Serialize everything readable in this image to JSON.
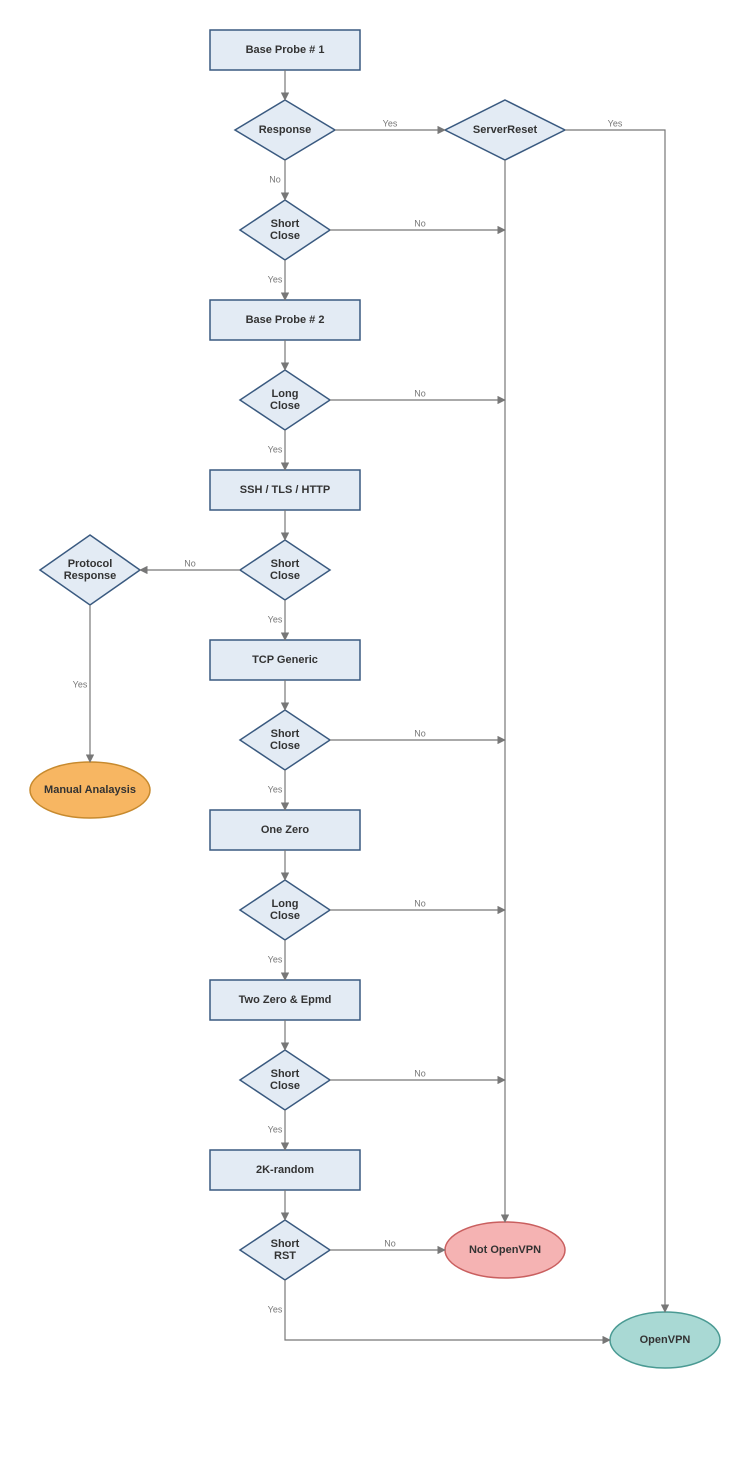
{
  "nodes": {
    "base_probe_1": "Base Probe # 1",
    "response": "Response",
    "server_reset": "ServerReset",
    "short_close_1": "Short\nClose",
    "base_probe_2": "Base Probe # 2",
    "long_close_1": "Long\nClose",
    "ssh_tls_http": "SSH / TLS / HTTP",
    "short_close_2": "Short\nClose",
    "protocol_response": "Protocol\nResponse",
    "manual_analysis": "Manual Analaysis",
    "tcp_generic": "TCP Generic",
    "short_close_3": "Short\nClose",
    "one_zero": "One Zero",
    "long_close_2": "Long\nClose",
    "two_zero_epmd": "Two Zero & Epmd",
    "short_close_4": "Short\nClose",
    "two_k_random": "2K-random",
    "short_rst": "Short\nRST",
    "not_openvpn": "Not OpenVPN",
    "openvpn": "OpenVPN"
  },
  "edge_labels": {
    "yes": "Yes",
    "no": "No"
  }
}
